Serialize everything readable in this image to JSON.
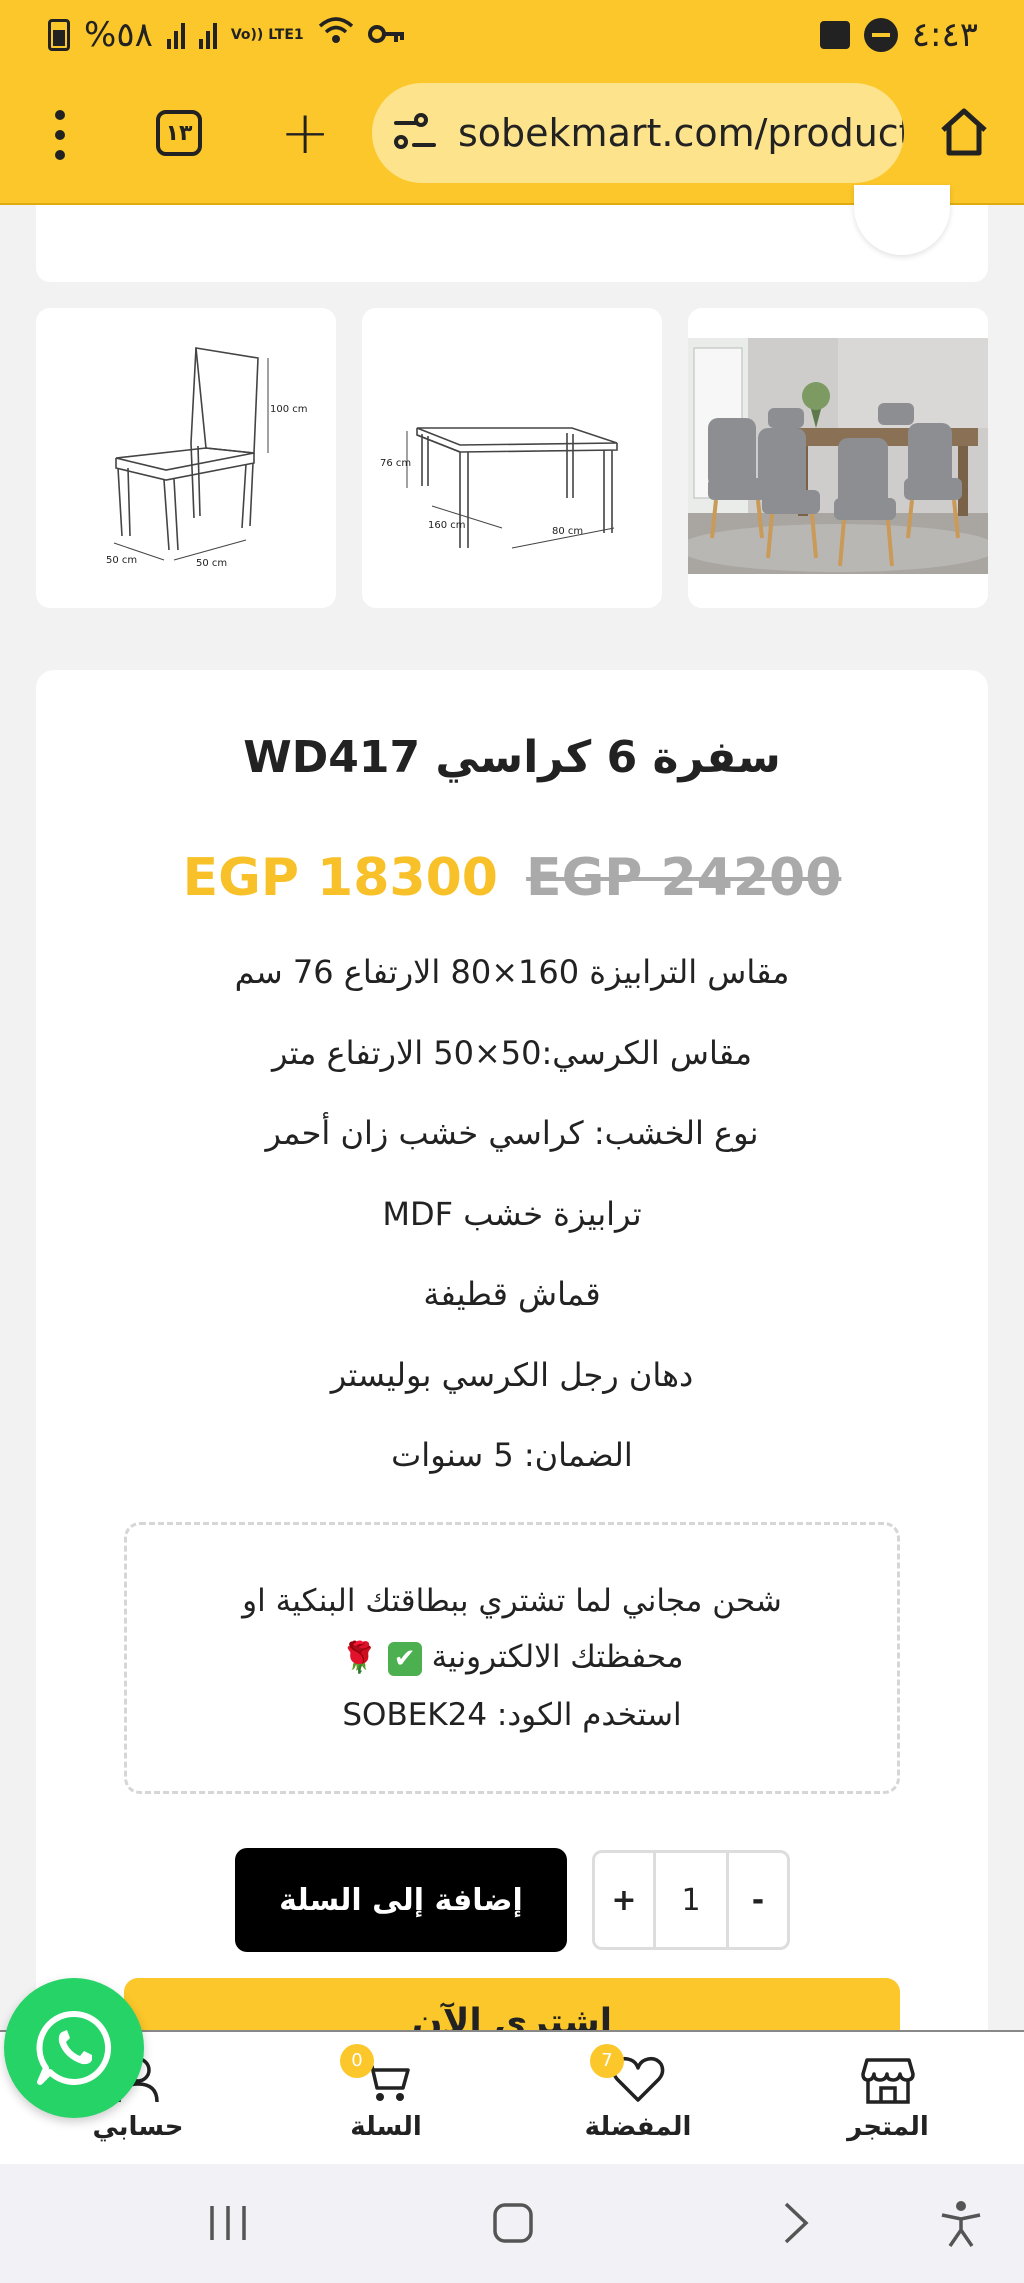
{
  "status_bar": {
    "time": "٤:٤٣",
    "battery": "%٥٨",
    "network": "Vo)) LTE1"
  },
  "browser": {
    "url": "sobekmart.com/product/",
    "tab_count": "١٣",
    "icons": [
      "menu-dots-icon",
      "tabs-icon",
      "plus-icon",
      "site-settings-icon",
      "home-icon"
    ]
  },
  "product": {
    "title": "سفرة 6 كراسي WD417",
    "price_sale": "EGP 18300",
    "price_regular": "EGP 24200",
    "specs": [
      "مقاس الترابيزة 160×80 الارتفاع 76 سم",
      "مقاس الكرسي:50×50 الارتفاع متر",
      "نوع الخشب: كراسي خشب زان أحمر",
      "ترابيزة خشب MDF",
      "قماش قطيفة",
      "دهان رجل الكرسي بوليستر",
      "الضمان: 5 سنوات"
    ],
    "thumb_labels": {
      "chair_height": "100 cm",
      "chair_w": "50 cm",
      "chair_d": "50 cm",
      "table_height": "76 cm",
      "table_l": "160 cm",
      "table_w": "80 cm"
    }
  },
  "promo": {
    "line1": "شحن مجاني لما تشتري ببطاقتك البنكية او",
    "line2": "محفظتك الالكترونية",
    "line3": "استخدم الكود: SOBEK24"
  },
  "cart": {
    "add_to_cart": "إضافة إلى السلة",
    "quantity": "1",
    "plus": "+",
    "minus": "-",
    "buy_now": "اشتري الآن"
  },
  "bottom_nav": {
    "store": "المتجر",
    "wishlist": "المفضلة",
    "wishlist_count": "7",
    "cart": "السلة",
    "cart_count": "0",
    "account": "حسابي"
  },
  "colors": {
    "brand_yellow": "#fcc72a",
    "whatsapp_green": "#25d366",
    "button_black": "#000000"
  }
}
